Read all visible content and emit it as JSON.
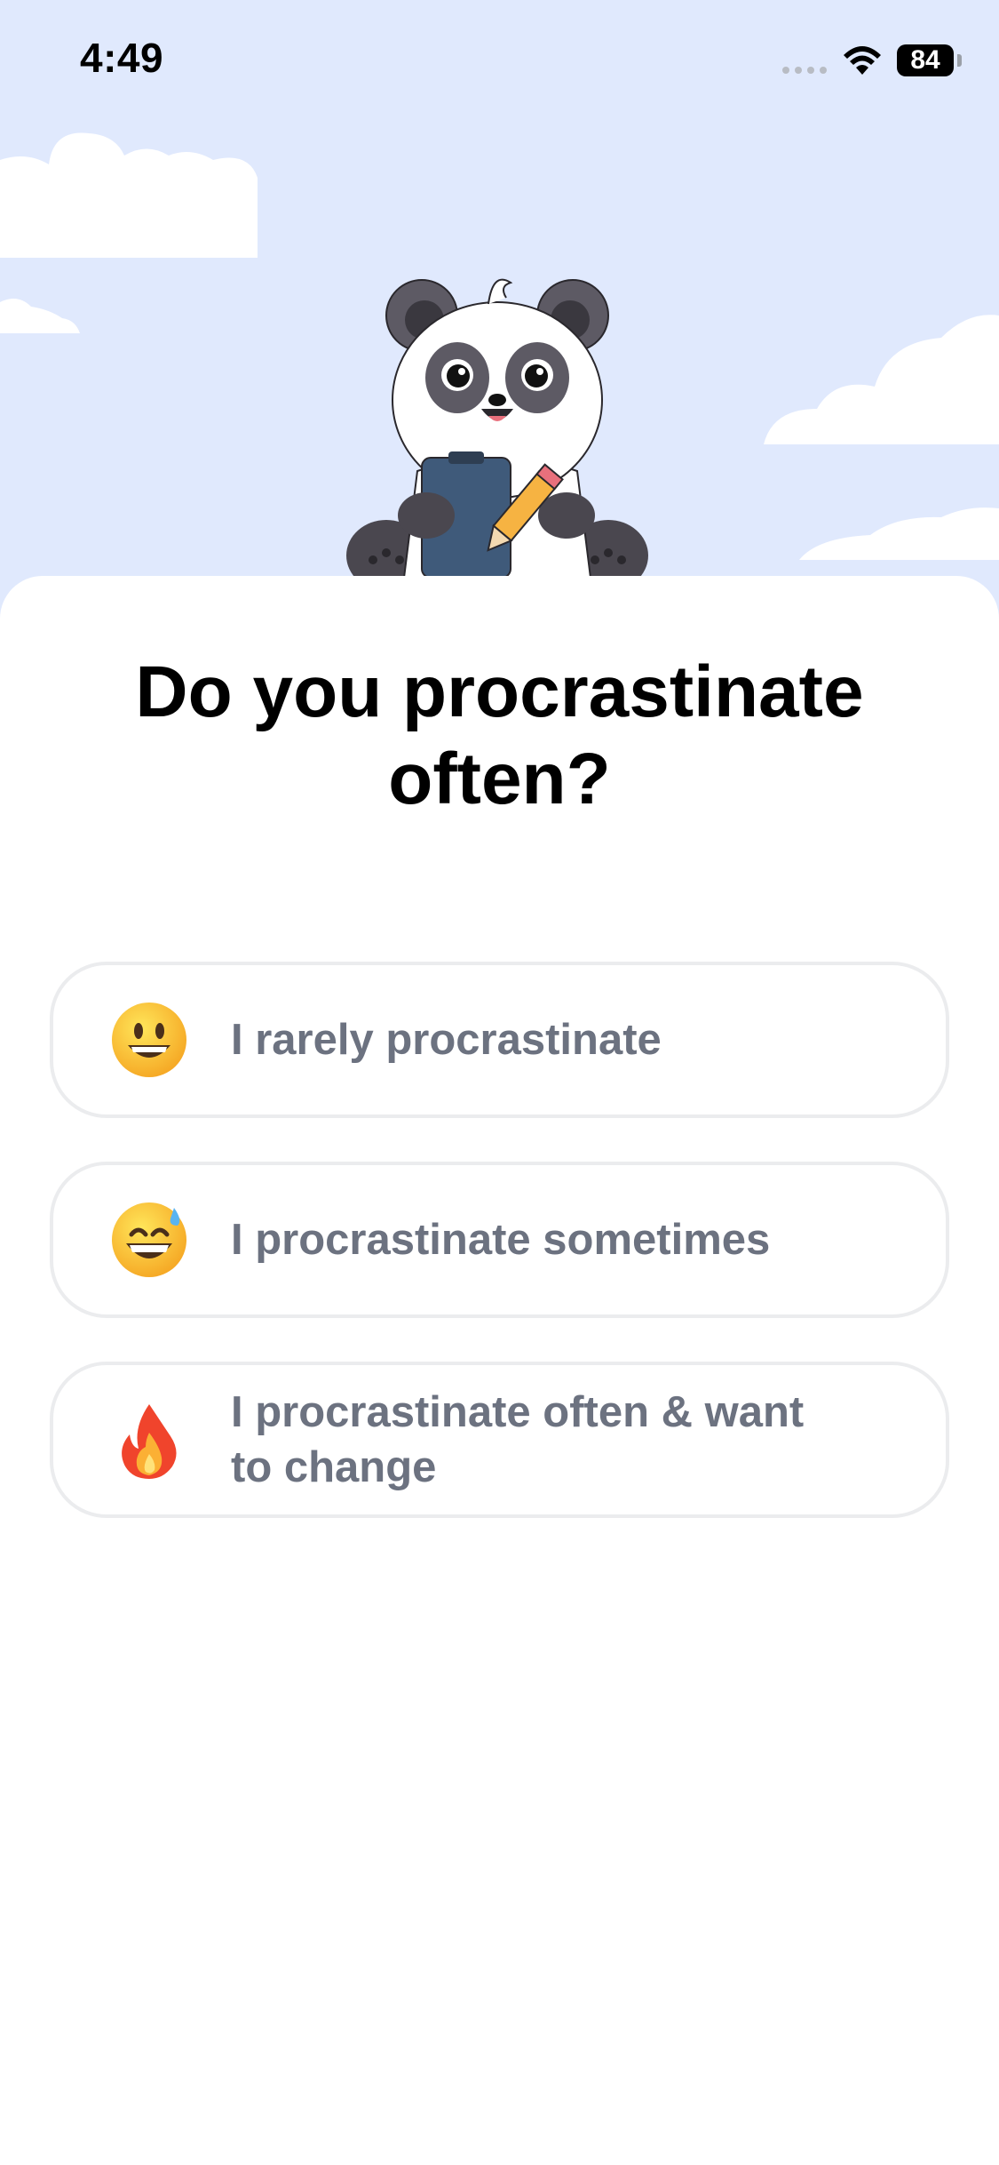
{
  "status_bar": {
    "time": "4:49",
    "battery": "84"
  },
  "question": {
    "title": "Do you procrastinate often?"
  },
  "options": [
    {
      "emoji": "grinning-face-icon",
      "label": "I rarely procrastinate"
    },
    {
      "emoji": "grinning-face-with-sweat-icon",
      "label": "I procrastinate sometimes"
    },
    {
      "emoji": "fire-icon",
      "label": "I procrastinate often & want to change"
    }
  ],
  "colors": {
    "sky": "#e0e9fd",
    "option_text": "#6c7280",
    "option_border": "#ebecee",
    "title_text": "#000000"
  }
}
